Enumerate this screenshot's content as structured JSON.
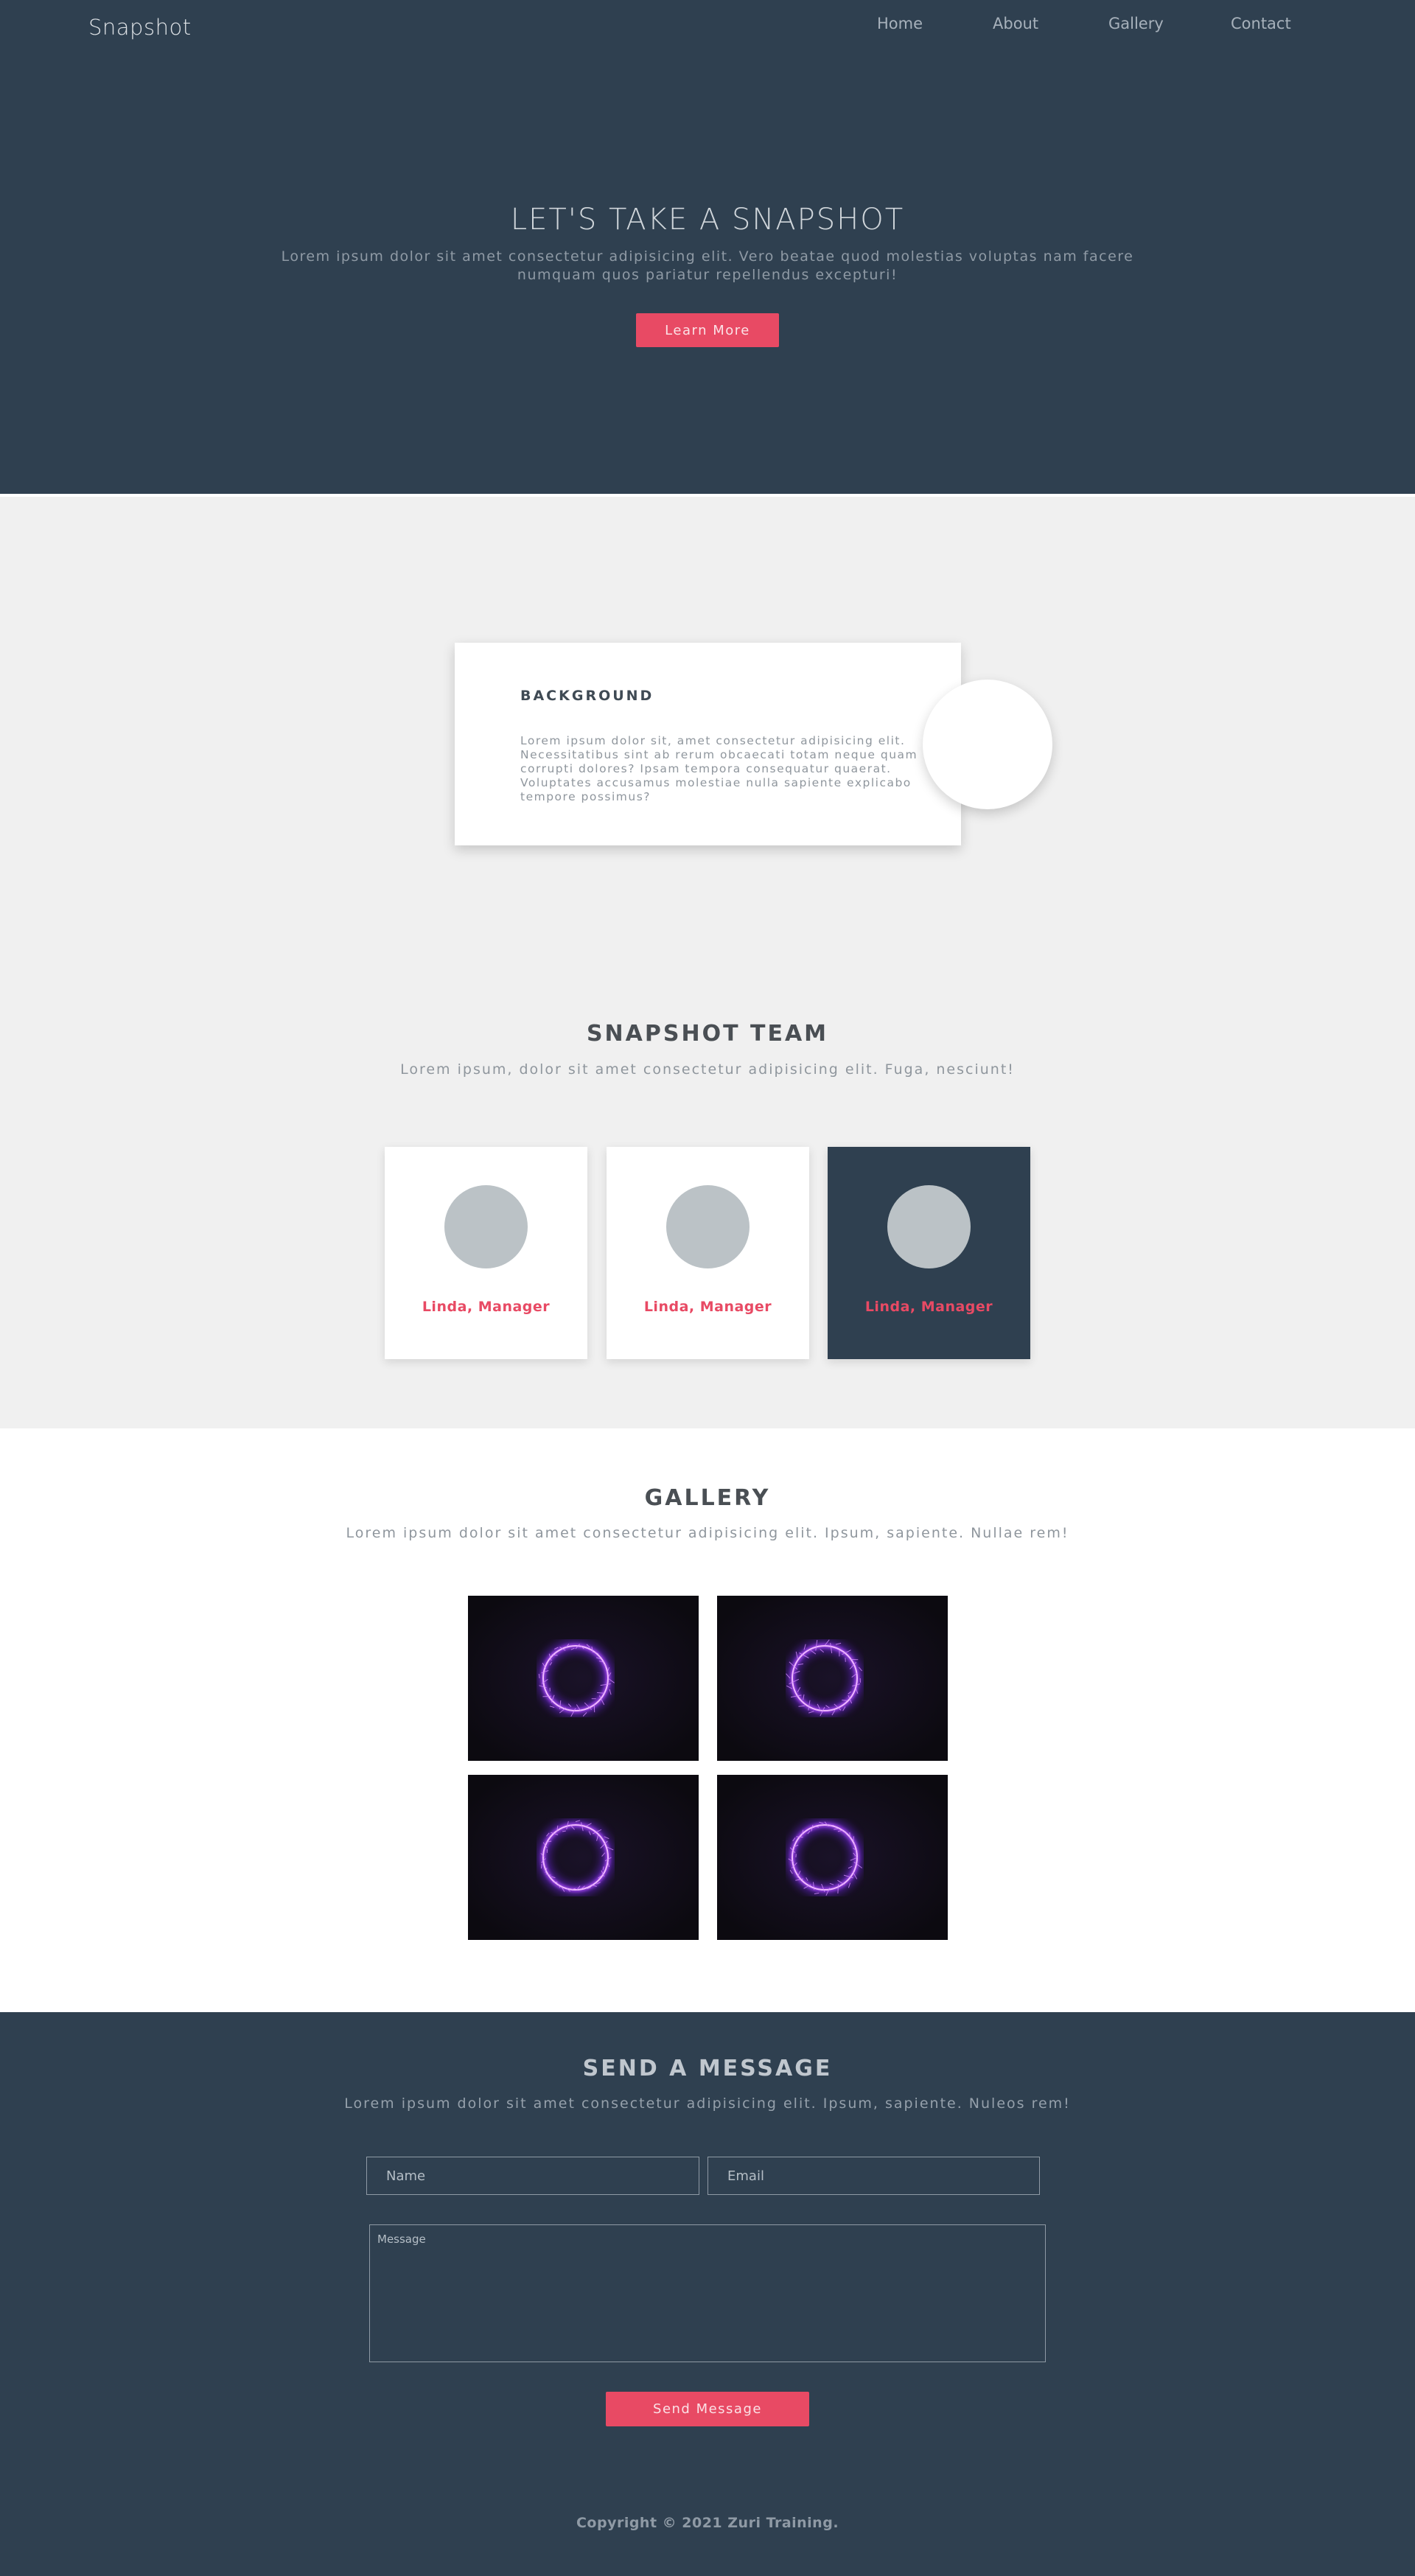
{
  "nav": {
    "logo": "Snapshot",
    "links": [
      "Home",
      "About",
      "Gallery",
      "Contact"
    ]
  },
  "hero": {
    "title": "LET'S TAKE A SNAPSHOT",
    "subtitle": "Lorem ipsum dolor sit amet consectetur adipisicing elit. Vero beatae quod molestias voluptas nam facere numquam quos pariatur repellendus excepturi!",
    "button": "Learn More"
  },
  "background": {
    "title": "BACKGROUND",
    "text": "Lorem ipsum dolor sit, amet consectetur adipisicing elit. Necessitatibus sint ab rerum obcaecati totam neque quam corrupti dolores? Ipsam tempora consequatur quaerat. Voluptates accusamus molestiae nulla sapiente explicabo tempore possimus?"
  },
  "team": {
    "title": "SNAPSHOT TEAM",
    "subtitle": "Lorem ipsum, dolor sit amet consectetur adipisicing elit. Fuga, nesciunt!",
    "members": [
      {
        "name": "Linda, Manager"
      },
      {
        "name": "Linda, Manager"
      },
      {
        "name": "Linda, Manager"
      }
    ]
  },
  "gallery": {
    "title": "GALLERY",
    "subtitle": "Lorem ipsum dolor sit amet consectetur adipisicing elit. Ipsum, sapiente. Nullae rem!"
  },
  "contact": {
    "title": "SEND A MESSAGE",
    "subtitle": "Lorem ipsum dolor sit amet consectetur adipisicing elit. Ipsum, sapiente. Nuleos rem!",
    "name_placeholder": "Name",
    "email_placeholder": "Email",
    "message_placeholder": "Message",
    "button": "Send Message"
  },
  "footer": {
    "text": "Copyright © 2021 Zuri Training."
  },
  "colors": {
    "dark": "#2f4050",
    "accent": "#e84a64",
    "light_bg": "#f0f0f0"
  }
}
